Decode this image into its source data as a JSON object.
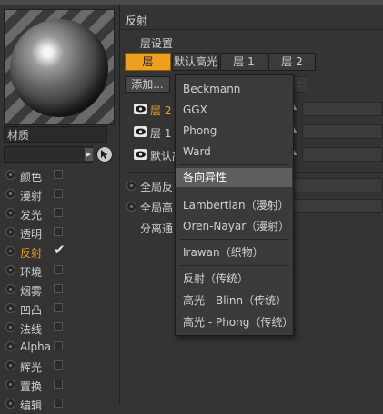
{
  "left_panel": {
    "material_name": "材质",
    "channels": [
      {
        "label": "颜色",
        "checked": false,
        "active": false
      },
      {
        "label": "漫射",
        "checked": false,
        "active": false
      },
      {
        "label": "发光",
        "checked": false,
        "active": false
      },
      {
        "label": "透明",
        "checked": false,
        "active": false
      },
      {
        "label": "反射",
        "checked": true,
        "active": true
      },
      {
        "label": "环境",
        "checked": false,
        "active": false
      },
      {
        "label": "烟雾",
        "checked": false,
        "active": false
      },
      {
        "label": "凹凸",
        "checked": false,
        "active": false
      },
      {
        "label": "法线",
        "checked": false,
        "active": false
      },
      {
        "label": "Alpha",
        "checked": false,
        "active": false
      },
      {
        "label": "辉光",
        "checked": false,
        "active": false
      },
      {
        "label": "置换",
        "checked": false,
        "active": false
      },
      {
        "label": "编辑",
        "checked": false,
        "active": false
      }
    ]
  },
  "right_panel": {
    "title": "反射",
    "layer_settings_label": "层设置",
    "tabs": [
      "层",
      "默认高光",
      "层 1",
      "层 2"
    ],
    "active_tab": "层",
    "add_button": "添加...",
    "layers": [
      {
        "label": "层 2",
        "active": true
      },
      {
        "label": "层 1",
        "active": false
      },
      {
        "label": "默认高",
        "active": false
      }
    ],
    "global_rows": [
      "全局反",
      "全局高"
    ],
    "separate_label": "分离通"
  },
  "dropdown": {
    "items": [
      {
        "label": "Beckmann",
        "highlighted": false
      },
      {
        "label": "GGX",
        "highlighted": false
      },
      {
        "label": "Phong",
        "highlighted": false
      },
      {
        "label": "Ward",
        "highlighted": false
      },
      {
        "label": "各向异性",
        "highlighted": true
      },
      {
        "label": "Lambertian（漫射）",
        "highlighted": false
      },
      {
        "label": "Oren-Nayar（漫射）",
        "highlighted": false
      },
      {
        "label": "Irawan（织物）",
        "highlighted": false
      },
      {
        "label": "反射（传统）",
        "highlighted": false
      },
      {
        "label": "高光 - Blinn（传统）",
        "highlighted": false
      },
      {
        "label": "高光 - Phong（传统）",
        "highlighted": false
      }
    ]
  },
  "colors": {
    "accent": "#f0a020",
    "panel_bg": "#333333",
    "menu_bg": "#3a3a3a",
    "menu_highlight": "#5e5e5e"
  },
  "icons": [
    "material-preview-sphere",
    "picker-arrow-icon",
    "eye-icon",
    "radio-icon",
    "checkbox-icon",
    "checkmark-icon",
    "spinner-arrows-icon"
  ]
}
